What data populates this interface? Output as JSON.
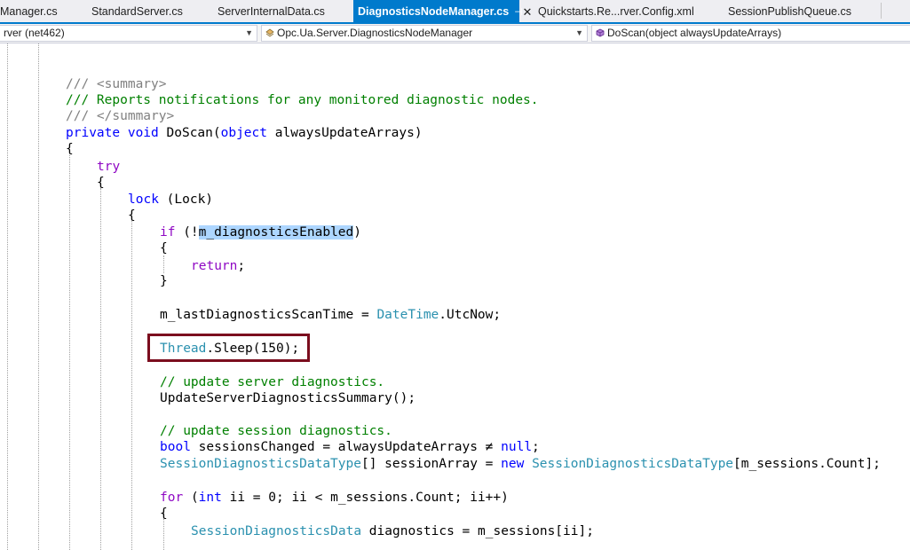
{
  "tabs": [
    {
      "label": "Manager.cs",
      "active": false
    },
    {
      "label": "StandardServer.cs",
      "active": false
    },
    {
      "label": "ServerInternalData.cs",
      "active": false
    },
    {
      "label": "DiagnosticsNodeManager.cs",
      "active": true
    },
    {
      "label": "Quickstarts.Re...rver.Config.xml",
      "active": false
    },
    {
      "label": "SessionPublishQueue.cs",
      "active": false
    }
  ],
  "tab_glyphs": {
    "pin": "⊣",
    "close": "✕"
  },
  "navbar": {
    "project": "rver (net462)",
    "type": "Opc.Ua.Server.DiagnosticsNodeManager",
    "member": "DoScan(object alwaysUpdateArrays)"
  },
  "colors": {
    "accent": "#007acc",
    "keyword": "#0000ff",
    "control": "#8f08c4",
    "type": "#2b91af",
    "comment": "#008000",
    "highlight_box": "#7b0d1e"
  },
  "icons": [
    "dropdown-arrow-icon",
    "class-icon",
    "method-icon",
    "pin-icon",
    "close-icon"
  ],
  "code": {
    "summary_open": "/// <summary>",
    "summary_text": "/// Reports notifications for any monitored diagnostic nodes.",
    "summary_close": "/// </summary>",
    "kw_private": "private",
    "kw_void": "void",
    "method_name": "DoScan(",
    "kw_object": "object",
    "param": "alwaysUpdateArrays)",
    "brace_open": "{",
    "brace_close": "}",
    "kw_try": "try",
    "kw_lock": "lock",
    "lock_arg": "(Lock)",
    "kw_if": "if",
    "if_open": "(!",
    "field_enabled": "m_diagnosticsEnabled",
    "paren_close": ")",
    "kw_return": "return",
    "semicolon": ";",
    "assign_lhs": "m_lastDiagnosticsScanTime = ",
    "type_datetime": "DateTime",
    "utcnow": ".UtcNow;",
    "type_thread": "Thread",
    "sleep_call": ".Sleep(150);",
    "comment_server": "// update server diagnostics.",
    "update_summary_call": "UpdateServerDiagnosticsSummary();",
    "comment_session": "// update session diagnostics.",
    "kw_bool": "bool",
    "sessions_changed": " sessionsChanged = alwaysUpdateArrays ≠ ",
    "kw_null": "null",
    "type_session_data_type": "SessionDiagnosticsDataType",
    "array_decl": "[] sessionArray = ",
    "kw_new": "new",
    "array_size": "[m_sessions.Count];",
    "kw_for": "for",
    "for_open": "(",
    "kw_int": "int",
    "for_rest": " ii = 0; ii < m_sessions.Count; ii++)",
    "type_session_data": "SessionDiagnosticsData",
    "diag_assign": " diagnostics = m_sessions[ii];"
  }
}
